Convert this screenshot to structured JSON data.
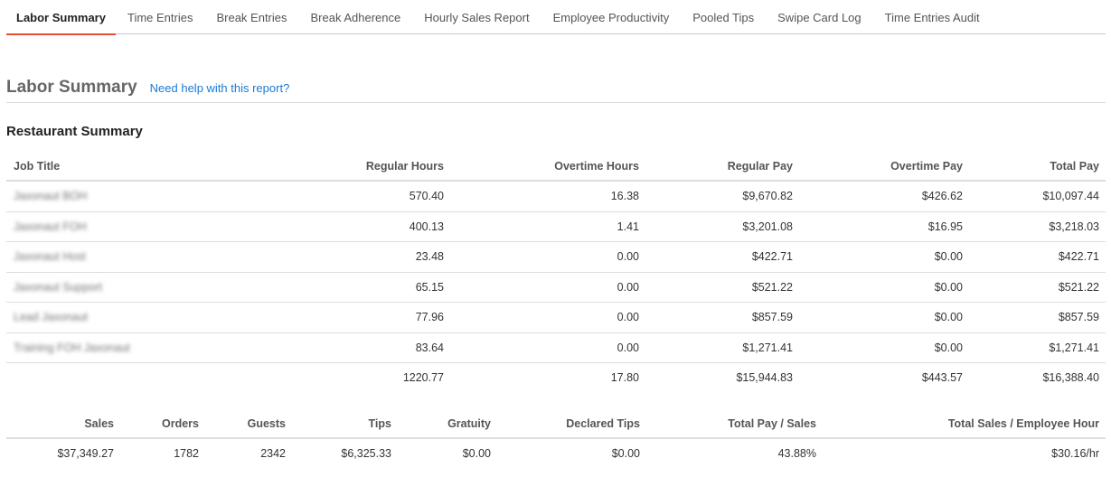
{
  "tabs": [
    "Labor Summary",
    "Time Entries",
    "Break Entries",
    "Break Adherence",
    "Hourly Sales Report",
    "Employee Productivity",
    "Pooled Tips",
    "Swipe Card Log",
    "Time Entries Audit"
  ],
  "active_tab": "Labor Summary",
  "page_title": "Labor Summary",
  "help_link": "Need help with this report?",
  "section_title": "Restaurant Summary",
  "colors": {
    "accent": "#e4502f",
    "link": "#1a7bd6"
  },
  "restaurant": {
    "headers": [
      "Job Title",
      "Regular Hours",
      "Overtime Hours",
      "Regular Pay",
      "Overtime Pay",
      "Total Pay"
    ],
    "rows": [
      [
        "Jaxonaut BOH",
        "570.40",
        "16.38",
        "$9,670.82",
        "$426.62",
        "$10,097.44"
      ],
      [
        "Jaxonaut FOH",
        "400.13",
        "1.41",
        "$3,201.08",
        "$16.95",
        "$3,218.03"
      ],
      [
        "Jaxonaut Host",
        "23.48",
        "0.00",
        "$422.71",
        "$0.00",
        "$422.71"
      ],
      [
        "Jaxonaut Support",
        "65.15",
        "0.00",
        "$521.22",
        "$0.00",
        "$521.22"
      ],
      [
        "Lead Jaxonaut",
        "77.96",
        "0.00",
        "$857.59",
        "$0.00",
        "$857.59"
      ],
      [
        "Training FOH Jaxonaut",
        "83.64",
        "0.00",
        "$1,271.41",
        "$0.00",
        "$1,271.41"
      ]
    ],
    "totals": [
      "",
      "1220.77",
      "17.80",
      "$15,944.83",
      "$443.57",
      "$16,388.40"
    ]
  },
  "sales": {
    "headers": [
      "Sales",
      "Orders",
      "Guests",
      "Tips",
      "Gratuity",
      "Declared Tips",
      "Total Pay / Sales",
      "Total Sales / Employee Hour"
    ],
    "values": [
      "$37,349.27",
      "1782",
      "2342",
      "$6,325.33",
      "$0.00",
      "$0.00",
      "43.88%",
      "$30.16/hr"
    ]
  }
}
